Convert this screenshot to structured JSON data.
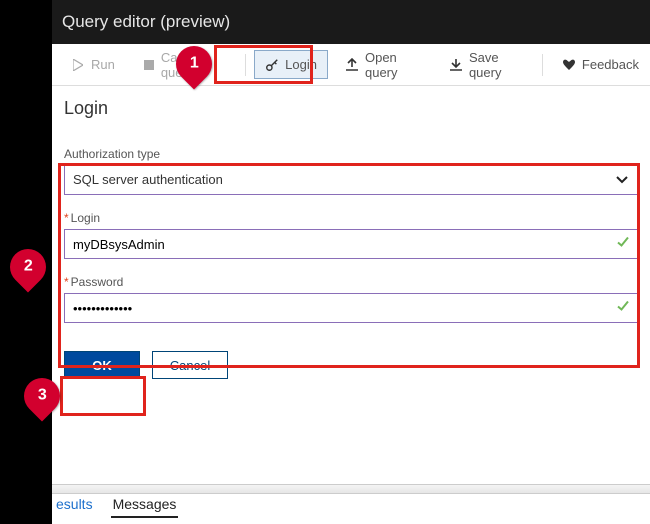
{
  "header": {
    "title": "Query editor (preview)"
  },
  "toolbar": {
    "run": "Run",
    "cancel": "Cancel query",
    "login": "Login",
    "open": "Open query",
    "save": "Save query",
    "feedback": "Feedback"
  },
  "page": {
    "title": "Login"
  },
  "form": {
    "auth_label": "Authorization type",
    "auth_value": "SQL server authentication",
    "login_label": "Login",
    "login_value": "myDBsysAdmin",
    "password_label": "Password",
    "password_value": "•••••••••••••"
  },
  "buttons": {
    "ok": "OK",
    "cancel": "Cancel"
  },
  "tabs": {
    "results": "esults",
    "messages": "Messages"
  },
  "callouts": {
    "one": "1",
    "two": "2",
    "three": "3"
  }
}
